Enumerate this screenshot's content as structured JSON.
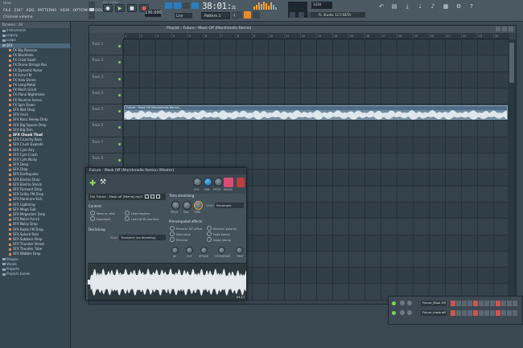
{
  "window": {
    "title": "User"
  },
  "menu": [
    "FILE",
    "EDIT",
    "ADD",
    "PATTERNS",
    "VIEW",
    "OPTIONS",
    "TOOLS",
    "?"
  ],
  "hint_text": "Channel volume",
  "transport": {
    "pat_label": "PAT",
    "song_label": "SONG",
    "tempo": "130.000"
  },
  "time_display": {
    "main": "38:01:",
    "frac": "21"
  },
  "line_mode": "Line",
  "pattern_selector": "Pattern 1",
  "cpu": {
    "value": "3434",
    "ram": "70"
  },
  "news_text": "FL Studio 12.5 BETA",
  "browser": {
    "header": "Browser - All",
    "items": [
      {
        "label": "Instruments",
        "type": "folder"
      },
      {
        "label": "Legacy",
        "type": "folder"
      },
      {
        "label": "Loops",
        "type": "folder"
      },
      {
        "label": "SFX",
        "type": "folder-sel"
      },
      {
        "label": "FX Big Reverse",
        "type": "file"
      },
      {
        "label": "FX Blackhole",
        "type": "file"
      },
      {
        "label": "FX Crest Swell",
        "type": "file"
      },
      {
        "label": "FX Drone Strings Rev",
        "type": "file"
      },
      {
        "label": "FX Dynamic Noise",
        "type": "file"
      },
      {
        "label": "FX Echo FM",
        "type": "file"
      },
      {
        "label": "FX Halo Drone",
        "type": "file"
      },
      {
        "label": "FX Long Metal",
        "type": "file"
      },
      {
        "label": "FX Mech Grind",
        "type": "file"
      },
      {
        "label": "FX Piano Nightmare",
        "type": "file"
      },
      {
        "label": "FX Reverse Series",
        "type": "file"
      },
      {
        "label": "FX Spin Down",
        "type": "file"
      },
      {
        "label": "SFX 8bit Drop",
        "type": "file"
      },
      {
        "label": "SFX Anvil",
        "type": "file"
      },
      {
        "label": "SFX Bass Sweep Drop",
        "type": "file"
      },
      {
        "label": "SFX Big Square Drop",
        "type": "file"
      },
      {
        "label": "SFX Big Tom",
        "type": "file"
      },
      {
        "label": "SFX Chunk Thud",
        "type": "file-bold"
      },
      {
        "label": "SFX Crunchy Bass",
        "type": "file"
      },
      {
        "label": "SFX Crush Explode",
        "type": "file"
      },
      {
        "label": "SFX Cym Airy",
        "type": "file"
      },
      {
        "label": "SFX Cym Crash",
        "type": "file"
      },
      {
        "label": "SFX Cym Noisy",
        "type": "file"
      },
      {
        "label": "SFX Deep",
        "type": "file"
      },
      {
        "label": "SFX Drop",
        "type": "file"
      },
      {
        "label": "SFX Earthquake",
        "type": "file"
      },
      {
        "label": "SFX Electro Drop",
        "type": "file"
      },
      {
        "label": "SFX Electro Shock",
        "type": "file"
      },
      {
        "label": "SFX Formant Drop",
        "type": "file"
      },
      {
        "label": "SFX Gritty FM Drop",
        "type": "file"
      },
      {
        "label": "SFX Hardcore Kick",
        "type": "file"
      },
      {
        "label": "SFX Lightning",
        "type": "file"
      },
      {
        "label": "SFX Mega Sub",
        "type": "file"
      },
      {
        "label": "SFX Megaslam Drop",
        "type": "file"
      },
      {
        "label": "SFX Noise Punch",
        "type": "file"
      },
      {
        "label": "SFX Noisy Drop",
        "type": "file"
      },
      {
        "label": "SFX Radio FM Drop",
        "type": "file"
      },
      {
        "label": "SFX Splash Rain",
        "type": "file"
      },
      {
        "label": "SFX Subbass Drop",
        "type": "file"
      },
      {
        "label": "SFX Thunder Street",
        "type": "file"
      },
      {
        "label": "SFX Thunder Tube",
        "type": "file"
      },
      {
        "label": "SFX Wobble Drop",
        "type": "file"
      },
      {
        "label": "Shapes",
        "type": "folder"
      },
      {
        "label": "Vocals",
        "type": "folder"
      },
      {
        "label": "Projects",
        "type": "folder"
      },
      {
        "label": "Projects bones",
        "type": "folder"
      }
    ]
  },
  "playlist": {
    "title": "Playlist - Future - Mask Off (Marshmello Remix)",
    "ruler": [
      "1",
      "2",
      "3",
      "4",
      "5",
      "6",
      "7",
      "8",
      "9",
      "10",
      "11",
      "12",
      "13",
      "14",
      "15",
      "16",
      "17",
      "18",
      "19",
      "20",
      "21",
      "22",
      "23",
      "24"
    ],
    "tracks": [
      {
        "label": "Track 1",
        "clip": ""
      },
      {
        "label": "Track 2",
        "clip": ""
      },
      {
        "label": "Track 3",
        "clip": ""
      },
      {
        "label": "Track 4",
        "clip": ""
      },
      {
        "label": "Track 5",
        "clip": "Future - Mask Off (Marshmello Remix)"
      },
      {
        "label": "Track 6",
        "clip": ""
      },
      {
        "label": "Track 7",
        "clip": ""
      },
      {
        "label": "Track 8",
        "clip": ""
      },
      {
        "label": "Track 9",
        "clip": ""
      },
      {
        "label": "Track 10",
        "clip": ""
      },
      {
        "label": "Track 11",
        "clip": ""
      },
      {
        "label": "Track 12",
        "clip": ""
      },
      {
        "label": "Track 13",
        "clip": ""
      },
      {
        "label": "Track 14",
        "clip": ""
      },
      {
        "label": "Track 15",
        "clip": ""
      },
      {
        "label": "Track 16",
        "clip": ""
      }
    ]
  },
  "sample": {
    "title": "Future - Mask Off (Marshmello Remix) (Master)",
    "knobs": [
      "VOL",
      "PAN",
      "PITCH",
      "RANGE"
    ],
    "file_label": "File",
    "file_name": "Future - Mask off (Remix).mp3",
    "content_label": "Content",
    "content_opts": [
      "Keep on disk",
      "Resample",
      "Load regions",
      "Load ACID markers"
    ],
    "declicking_label": "Declicking",
    "mode_label": "Mode",
    "declick_mode": "Transient (no bleeding)",
    "time_label": "Time stretching",
    "ts_knobs": [
      "PITCH",
      "MUL",
      "TIME"
    ],
    "ts_mode_label": "Mode",
    "ts_mode": "Resample",
    "precomp_label": "Precomputed effects",
    "precomp": [
      "Remove DC offset",
      "Normalize",
      "Reverse",
      "Reverse polarity",
      "Fade stereo",
      "Swap stereo"
    ],
    "bottom_knobs": [
      "IN",
      "OUT",
      "ATTACK",
      "CROSSFADE",
      "TRIM"
    ],
    "timestamp": "03:17"
  },
  "mixer": {
    "rows": [
      {
        "name": "Future_Mask Off"
      },
      {
        "name": "Future_mask off"
      }
    ]
  }
}
